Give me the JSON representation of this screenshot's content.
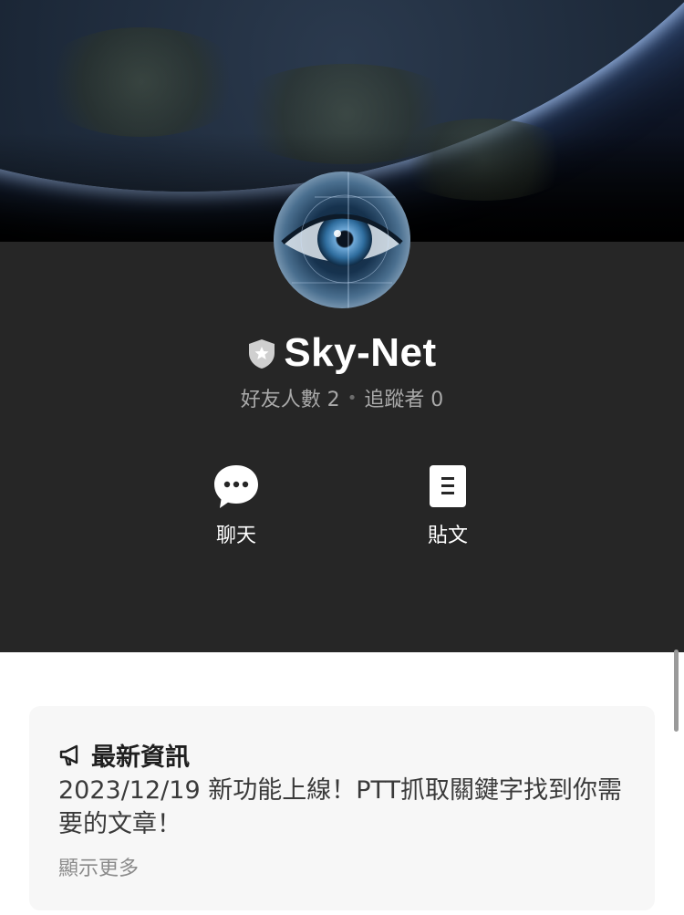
{
  "profile": {
    "name": "Sky-Net",
    "friends_label": "好友人數 2",
    "followers_label": "追蹤者 0",
    "stat_separator": "•"
  },
  "actions": {
    "chat_label": "聊天",
    "post_label": "貼文"
  },
  "news": {
    "title": "最新資訊",
    "body": "2023/12/19 新功能上線！PTT抓取關鍵字找到你需要的文章！",
    "more_label": "顯示更多"
  },
  "icons": {
    "shield": "shield-star-icon",
    "chat": "chat-bubble-icon",
    "post": "document-icon",
    "news": "megaphone-icon"
  },
  "colors": {
    "panel_bg": "#262626",
    "card_bg": "#f7f7f7",
    "stat_text": "#a9a9a9"
  }
}
